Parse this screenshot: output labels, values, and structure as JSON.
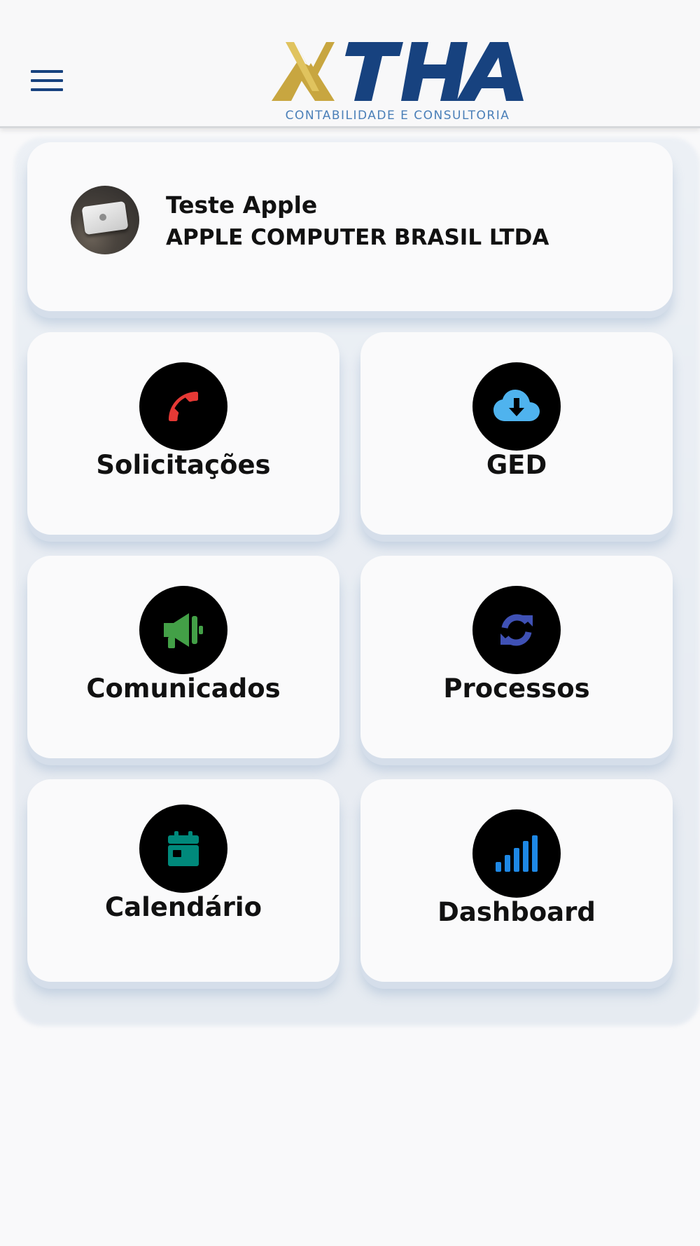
{
  "header": {
    "logo_text": "XTHA",
    "logo_tagline": "CONTABILIDADE E CONSULTORIA",
    "menu_icon": "hamburger-menu-icon",
    "brand_colors": {
      "gold": "#c8a640",
      "navy": "#17427f"
    }
  },
  "profile": {
    "name": "Teste Apple",
    "company": "APPLE COMPUTER BRASIL LTDA",
    "avatar": "avatar-photo"
  },
  "tiles": [
    {
      "label": "Solicitações",
      "icon": "phone-icon",
      "color": "#e53935"
    },
    {
      "label": "GED",
      "icon": "cloud-download-icon",
      "color": "#4fb3ee"
    },
    {
      "label": "Comunicados",
      "icon": "megaphone-icon",
      "color": "#43a047"
    },
    {
      "label": "Processos",
      "icon": "refresh-icon",
      "color": "#3f51b5"
    },
    {
      "label": "Calendário",
      "icon": "calendar-icon",
      "color": "#00897b"
    },
    {
      "label": "Dashboard",
      "icon": "signal-bars-icon",
      "color": "#1e88e5"
    }
  ]
}
